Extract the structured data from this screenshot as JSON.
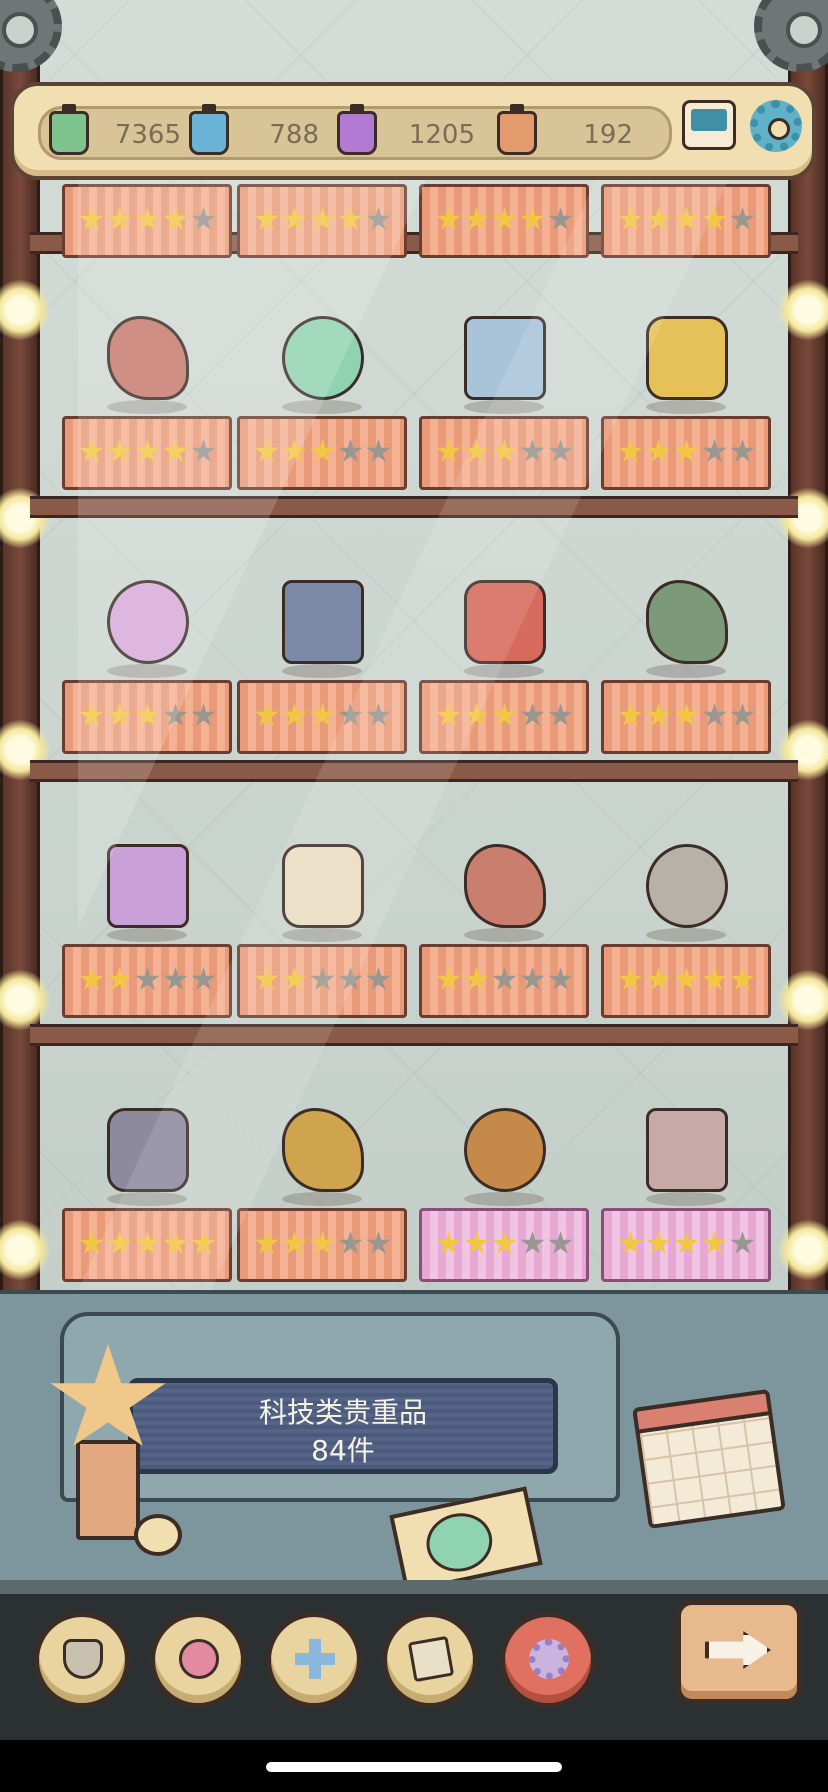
{
  "resources": [
    {
      "icon": "green-potion-jar-icon",
      "color": "#7fc48e",
      "value": "7365"
    },
    {
      "icon": "blue-potion-jar-icon",
      "color": "#6ab4d8",
      "value": "788"
    },
    {
      "icon": "purple-potion-jar-icon",
      "color": "#b27ad2",
      "value": "1205"
    },
    {
      "icon": "orange-potion-jar-icon",
      "color": "#e39a6c",
      "value": "192"
    }
  ],
  "shelves": [
    {
      "row": 0,
      "cells": [
        {
          "stars": 4,
          "pink": false
        },
        {
          "stars": 4,
          "pink": false
        },
        {
          "stars": 4,
          "pink": false
        },
        {
          "stars": 4,
          "pink": false
        }
      ]
    },
    {
      "row": 1,
      "cells": [
        {
          "item": "steampunk-engine-icon",
          "stars": 4,
          "pink": false
        },
        {
          "item": "green-crystal-icon",
          "stars": 3,
          "pink": false
        },
        {
          "item": "satellite-icon",
          "stars": 3,
          "pink": false
        },
        {
          "item": "gold-ore-icon",
          "stars": 3,
          "pink": false
        }
      ]
    },
    {
      "row": 2,
      "cells": [
        {
          "item": "puzzle-cube-icon",
          "stars": 3,
          "pink": false
        },
        {
          "item": "scientist-book-icon",
          "stars": 3,
          "pink": false
        },
        {
          "item": "red-robot-eye-icon",
          "stars": 3,
          "pink": false
        },
        {
          "item": "radioactive-barrel-icon",
          "stars": 3,
          "pink": false
        }
      ]
    },
    {
      "row": 3,
      "cells": [
        {
          "item": "dna-helix-icon",
          "stars": 2,
          "pink": false
        },
        {
          "item": "documents-icon",
          "stars": 2,
          "pink": false
        },
        {
          "item": "sphere-machine-icon",
          "stars": 2,
          "pink": false
        },
        {
          "item": "mech-robot-icon",
          "stars": 5,
          "pink": false
        }
      ]
    },
    {
      "row": 4,
      "cells": [
        {
          "item": "box-robot-icon",
          "stars": 5,
          "pink": false
        },
        {
          "item": "flywheel-engine-icon",
          "stars": 3,
          "pink": false
        },
        {
          "item": "brass-cannon-icon",
          "stars": 3,
          "pink": true
        },
        {
          "item": "wheel-machine-icon",
          "stars": 4,
          "pink": true
        }
      ]
    }
  ],
  "plaque": {
    "title": "科技类贵重品",
    "count": "84件"
  },
  "nav": [
    {
      "name": "trophy-tab",
      "icon": "trophy-icon"
    },
    {
      "name": "rose-tab",
      "icon": "rose-icon"
    },
    {
      "name": "cross-tab",
      "icon": "cross-icon"
    },
    {
      "name": "scroll-tab",
      "icon": "scroll-icon"
    },
    {
      "name": "tech-tab",
      "icon": "gear-icon",
      "active": true
    }
  ],
  "colors": {
    "cloth": "#f4b193",
    "cloth_pink": "#f1c4e3",
    "star_on": "#f2c744",
    "star_off": "#9a9690",
    "plaque": "#4b5a78"
  }
}
